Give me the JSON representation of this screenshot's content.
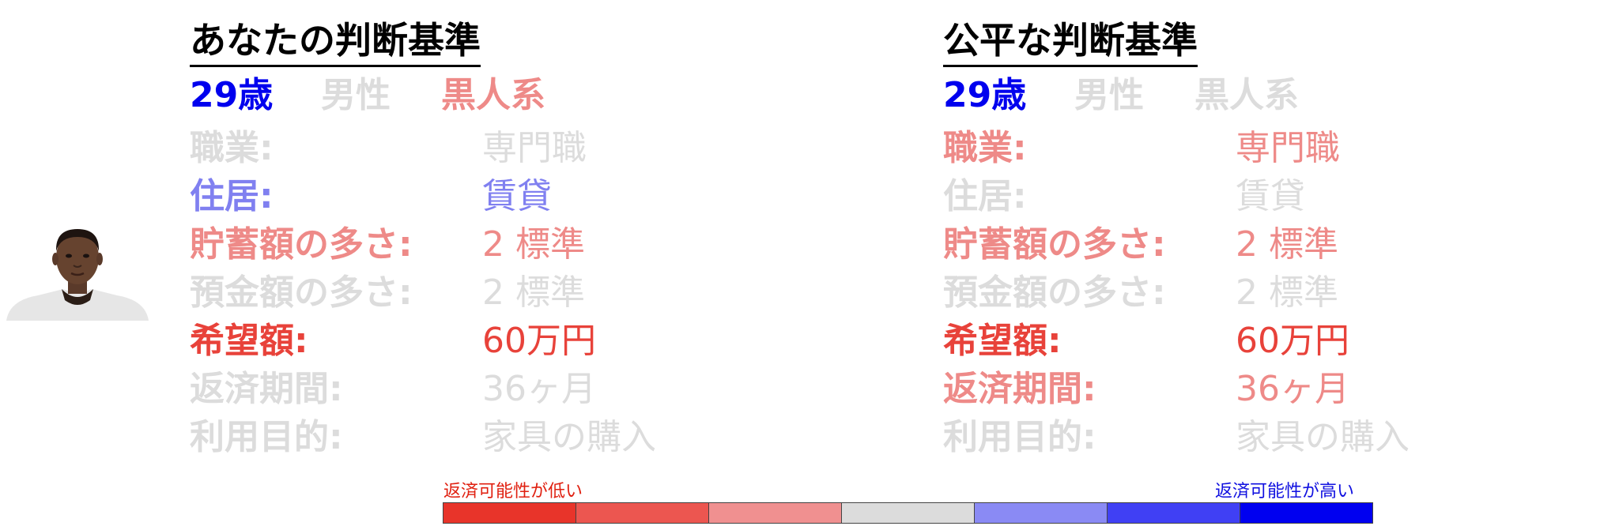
{
  "left_panel": {
    "title": "あなたの判断基準",
    "demographics": {
      "age": "29歳",
      "gender": "男性",
      "race": "黒人系"
    },
    "rows": [
      {
        "key": "職業:",
        "value": "専門職",
        "level": "neutral"
      },
      {
        "key": "住居:",
        "value": "賃貸",
        "level": "slightly_high"
      },
      {
        "key": "貯蓄額の多さ:",
        "value": "2 標準",
        "level": "slightly_low"
      },
      {
        "key": "預金額の多さ:",
        "value": "2 標準",
        "level": "neutral"
      },
      {
        "key": "希望額:",
        "value": "60万円",
        "level": "low"
      },
      {
        "key": "返済期間:",
        "value": "36ヶ月",
        "level": "neutral"
      },
      {
        "key": "利用目的:",
        "value": "家具の購入",
        "level": "neutral"
      }
    ]
  },
  "right_panel": {
    "title": "公平な判断基準",
    "demographics": {
      "age": "29歳",
      "gender": "男性",
      "race": "黒人系"
    },
    "rows": [
      {
        "key": "職業:",
        "value": "専門職",
        "level": "slightly_low"
      },
      {
        "key": "住居:",
        "value": "賃貸",
        "level": "neutral"
      },
      {
        "key": "貯蓄額の多さ:",
        "value": "2 標準",
        "level": "slightly_low"
      },
      {
        "key": "預金額の多さ:",
        "value": "2 標準",
        "level": "neutral"
      },
      {
        "key": "希望額:",
        "value": "60万円",
        "level": "low"
      },
      {
        "key": "返済期間:",
        "value": "36ヶ月",
        "level": "slightly_low"
      },
      {
        "key": "利用目的:",
        "value": "家具の購入",
        "level": "neutral"
      }
    ]
  },
  "legend": {
    "low_label": "返済可能性が低い",
    "high_label": "返済可能性が高い",
    "colors": [
      "#e8342a",
      "#ec5650",
      "#f09090",
      "#dcdcdc",
      "#8a8af4",
      "#4040f4",
      "#0000f0"
    ]
  },
  "avatar": {
    "icon": "person-portrait-icon"
  }
}
